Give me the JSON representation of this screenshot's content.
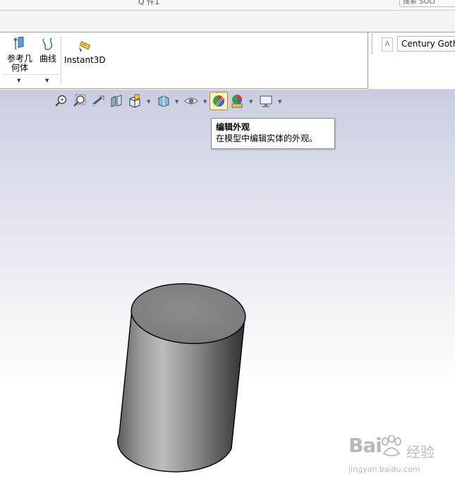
{
  "top": {
    "cut_text": "Q 件1",
    "search_label": "搜索 SOLI"
  },
  "ribbon": {
    "ref_geometry_line1": "参考几",
    "ref_geometry_line2": "何体",
    "curves": "曲线",
    "instant3d": "Instant3D"
  },
  "font_panel": {
    "font_name": "Century Gothic"
  },
  "tooltip": {
    "title": "编辑外观",
    "description": "在模型中编辑实体的外观。"
  },
  "watermark": {
    "brand": "Bai",
    "brand_suffix": "经验",
    "site": "jingyan.baidu.com"
  },
  "colors": {
    "tooltip_border": "#8b8b8b",
    "viewport_top": "#c9cde0",
    "active_icon_bg": "#fff3c4"
  },
  "hud_icons": [
    "zoom-to-fit-icon",
    "zoom-to-area-icon",
    "previous-view-icon",
    "section-view-icon",
    "view-orientation-icon",
    "display-style-icon",
    "hide-show-icon",
    "edit-appearance-icon",
    "apply-scene-icon",
    "view-settings-icon"
  ]
}
